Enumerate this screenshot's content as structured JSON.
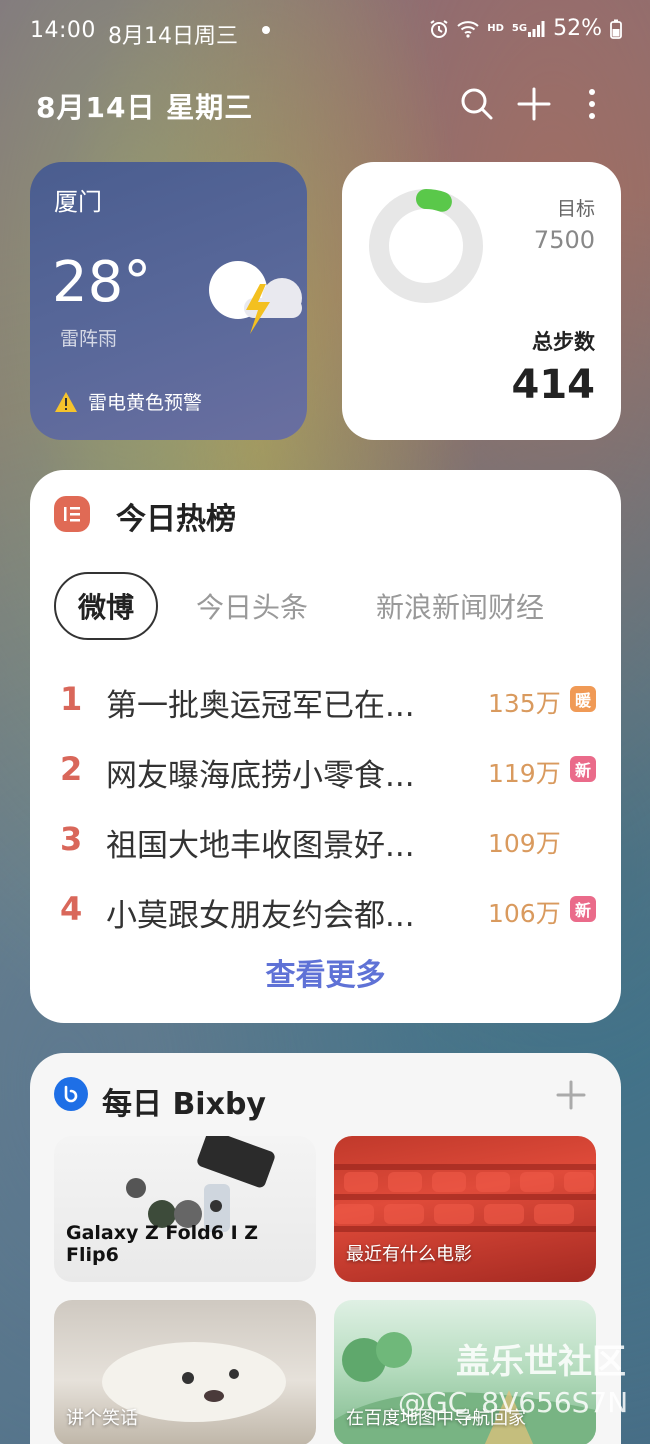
{
  "status_bar": {
    "time": "14:00",
    "date": "8月14日周三",
    "network_small": "HD",
    "network_gen": "5G",
    "battery": "52%"
  },
  "header": {
    "date": "8月14日 星期三"
  },
  "weather": {
    "city": "厦门",
    "temperature": "28°",
    "condition": "雷阵雨",
    "alert": "雷电黄色预警"
  },
  "steps": {
    "goal_label": "目标",
    "goal_value": "7500",
    "total_label": "总步数",
    "total_value": "414",
    "progress": 0.055
  },
  "hot_list": {
    "title": "今日热榜",
    "tabs": [
      "微博",
      "今日头条",
      "新浪新闻财经"
    ],
    "items": [
      {
        "rank": "1",
        "text": "第一批奥运冠军已在...",
        "count": "135万",
        "badge": "暖",
        "badge_type": "warm"
      },
      {
        "rank": "2",
        "text": "网友曝海底捞小零食...",
        "count": "119万",
        "badge": "新",
        "badge_type": "new"
      },
      {
        "rank": "3",
        "text": "祖国大地丰收图景好...",
        "count": "109万",
        "badge": "",
        "badge_type": "none"
      },
      {
        "rank": "4",
        "text": "小莫跟女朋友约会都...",
        "count": "106万",
        "badge": "新",
        "badge_type": "new"
      }
    ],
    "see_more": "查看更多"
  },
  "bixby": {
    "title": "每日 Bixby",
    "tiles": [
      {
        "label": "Galaxy Z Fold6 I Z Flip6"
      },
      {
        "label": "最近有什么电影"
      },
      {
        "label": "讲个笑话"
      },
      {
        "label": "在百度地图中导航回家"
      }
    ]
  },
  "watermark": {
    "line1": "盖乐世社区",
    "line2": "@GC_8V656S7N"
  },
  "colors": {
    "accent_blue": "#5f72d6",
    "rank_red": "#d9675a",
    "count_orange": "#d99a5e",
    "steps_green": "#5ac84a"
  }
}
